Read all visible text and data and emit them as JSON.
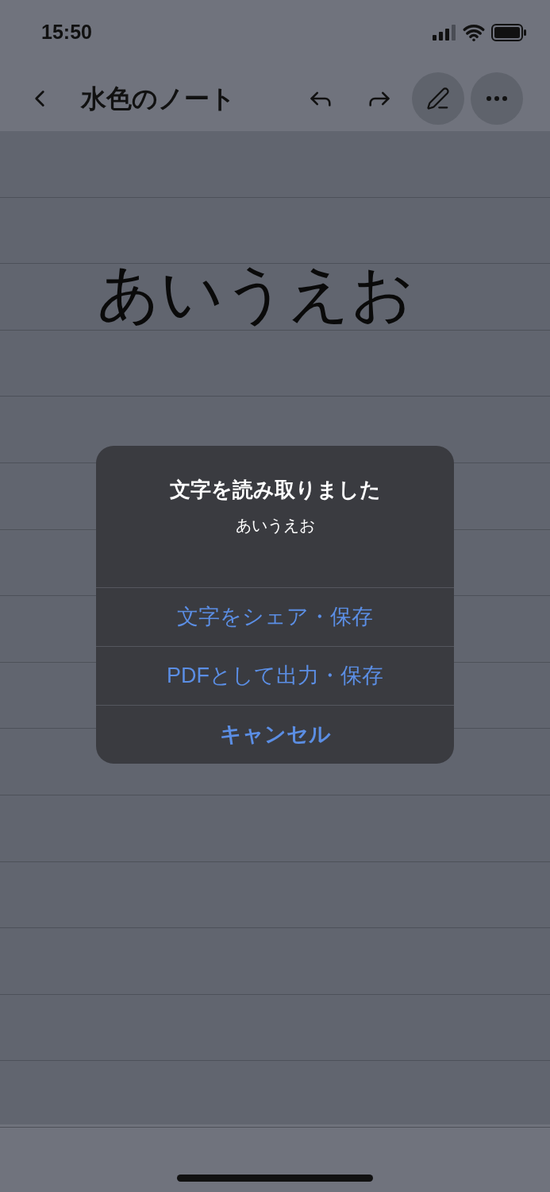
{
  "status_bar": {
    "time": "15:50"
  },
  "header": {
    "title": "水色のノート",
    "tools": [
      {
        "kind": "undo"
      },
      {
        "kind": "redo"
      },
      {
        "kind": "pen"
      },
      {
        "kind": "more"
      }
    ]
  },
  "note": {
    "handwriting": "あいうえお"
  },
  "alert": {
    "title": "文字を読み取りました",
    "message": "あいうえお",
    "actions": [
      {
        "label": "文字をシェア・保存",
        "kind": "default"
      },
      {
        "label": "PDFとして出力・保存",
        "kind": "default"
      },
      {
        "label": "キャンセル",
        "kind": "cancel"
      }
    ]
  }
}
